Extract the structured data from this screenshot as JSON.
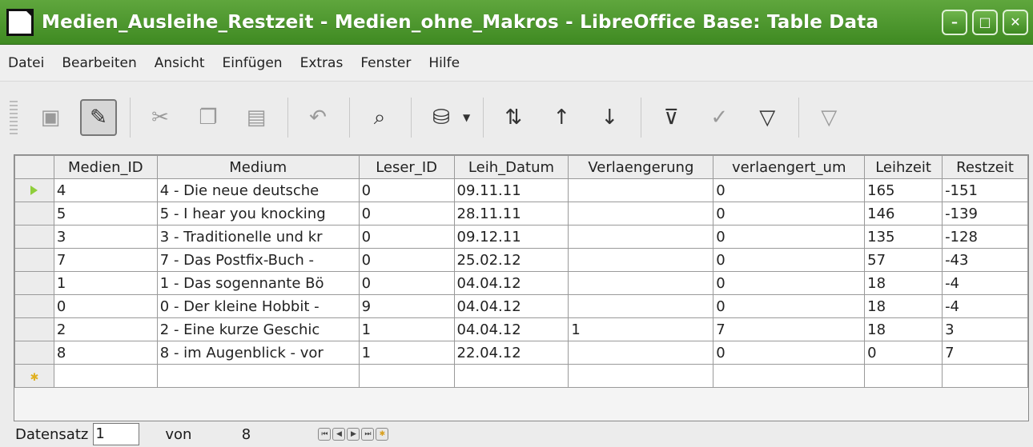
{
  "window": {
    "title": "Medien_Ausleihe_Restzeit - Medien_ohne_Makros - LibreOffice Base: Table Data",
    "accent_color": "#4a9a2c",
    "buttons": [
      "minimize-icon",
      "maximize-icon",
      "close-icon"
    ]
  },
  "menu": [
    "Datei",
    "Bearbeiten",
    "Ansicht",
    "Einfügen",
    "Extras",
    "Fenster",
    "Hilfe"
  ],
  "toolbar": {
    "buttons": [
      {
        "name": "save-icon",
        "glyph": "💾"
      },
      {
        "name": "edit-data-icon",
        "glyph": "✎"
      },
      {
        "name": "cut-icon",
        "glyph": "✂"
      },
      {
        "name": "copy-icon",
        "glyph": "⎘"
      },
      {
        "name": "paste-icon",
        "glyph": "📋"
      },
      {
        "name": "undo-icon",
        "glyph": "↶"
      },
      {
        "name": "find-record-icon",
        "glyph": "🔍"
      },
      {
        "name": "refresh-icon",
        "glyph": "⟳"
      },
      {
        "name": "sort-icon",
        "glyph": "⇅"
      },
      {
        "name": "sort-ascending-icon",
        "glyph": "↑"
      },
      {
        "name": "sort-descending-icon",
        "glyph": "↓"
      },
      {
        "name": "autofilter-icon",
        "glyph": "⊽"
      },
      {
        "name": "apply-filter-icon",
        "glyph": "✓"
      },
      {
        "name": "standard-filter-icon",
        "glyph": "▽"
      },
      {
        "name": "reset-filter-icon",
        "glyph": "▽"
      }
    ]
  },
  "grid": {
    "columns": [
      "Medien_ID",
      "Medium",
      "Leser_ID",
      "Leih_Datum",
      "Verlaengerung",
      "verlaengert_um",
      "Leihzeit",
      "Restzeit"
    ],
    "rows": [
      [
        "4",
        "4 - Die neue deutsche",
        "0",
        "09.11.11",
        "",
        "0",
        "165",
        "-151"
      ],
      [
        "5",
        "5 - I hear you knocking",
        "0",
        "28.11.11",
        "",
        "0",
        "146",
        "-139"
      ],
      [
        "3",
        "3 - Traditionelle und kr",
        "0",
        "09.12.11",
        "",
        "0",
        "135",
        "-128"
      ],
      [
        "7",
        "7 - Das Postfix-Buch -",
        "0",
        "25.02.12",
        "",
        "0",
        "57",
        "-43"
      ],
      [
        "1",
        "1 - Das sogennante Bö",
        "0",
        "04.04.12",
        "",
        "0",
        "18",
        "-4"
      ],
      [
        "0",
        "0 - Der kleine Hobbit -",
        "9",
        "04.04.12",
        "",
        "0",
        "18",
        "-4"
      ],
      [
        "2",
        "2 - Eine kurze Geschic",
        "1",
        "04.04.12",
        "1",
        "7",
        "18",
        "3"
      ],
      [
        "8",
        "8 - im Augenblick - vor",
        "1",
        "22.04.12",
        "",
        "0",
        "0",
        "7"
      ]
    ],
    "current_row": 0
  },
  "navigation": {
    "label": "Datensatz",
    "current": "1",
    "of_label": "von",
    "total": "8"
  }
}
